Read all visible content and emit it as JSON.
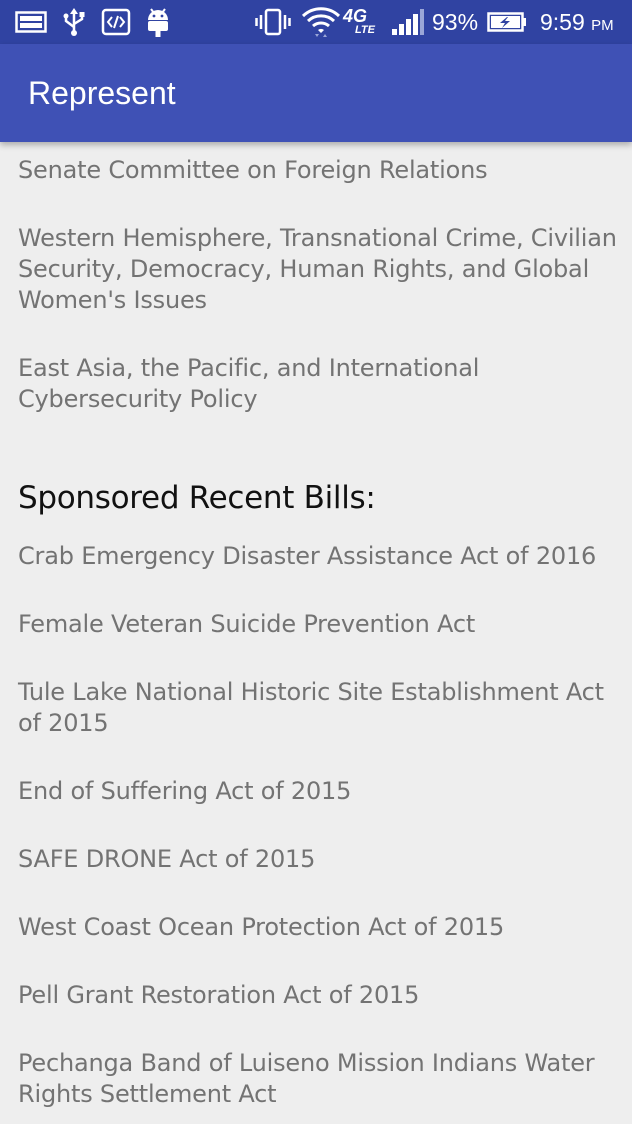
{
  "status_bar": {
    "icons": [
      "gallery-icon",
      "usb-icon",
      "developer-code-icon",
      "android-icon",
      "vibrate-icon",
      "wifi-icon",
      "4g-lte-icon",
      "signal-icon",
      "battery-charging-icon"
    ],
    "network_label_top": "4G",
    "network_label_bottom": "LTE",
    "battery_percent": "93%",
    "time": "9:59",
    "time_suffix": "PM"
  },
  "app_bar": {
    "title": "Represent"
  },
  "committees": [
    "Senate Committee on Foreign Relations",
    "Western Hemisphere, Transnational Crime, Civilian Security, Democracy, Human Rights, and Global Women's Issues",
    "East Asia, the Pacific, and International Cybersecurity Policy"
  ],
  "bills_section": {
    "heading": "Sponsored Recent Bills:",
    "bills": [
      "Crab Emergency Disaster Assistance Act of 2016",
      "Female Veteran Suicide Prevention Act",
      "Tule Lake National Historic Site Establishment Act of 2015",
      "End of Suffering Act of 2015",
      "SAFE DRONE Act of 2015",
      "West Coast Ocean Protection Act of 2015",
      "Pell Grant Restoration Act of 2015",
      "Pechanga Band of Luiseno Mission Indians Water Rights Settlement Act"
    ]
  }
}
